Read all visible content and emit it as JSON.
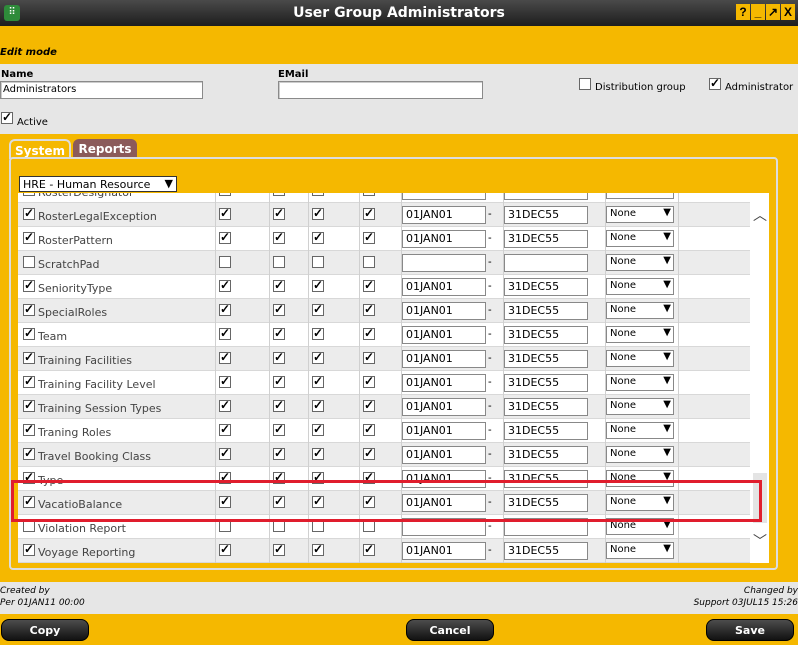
{
  "window": {
    "title": "User Group Administrators",
    "help": "?",
    "minimize": "_",
    "maximize": "↗",
    "close": "X"
  },
  "edit_mode": "Edit mode",
  "form": {
    "name_label": "Name",
    "name_value": "Administrators",
    "email_label": "EMail",
    "email_value": "",
    "distribution_label": "Distribution group",
    "distribution_checked": false,
    "administrator_label": "Administrator",
    "administrator_checked": true,
    "active_label": "Active",
    "active_checked": true
  },
  "tabs": [
    {
      "label": "System",
      "active": true
    },
    {
      "label": "Reports",
      "active": false
    }
  ],
  "module_select": {
    "value": "HRE - Human Resource"
  },
  "rows": [
    {
      "name": "RosterDesignator",
      "checked": true,
      "perms": [
        true,
        true,
        true,
        true
      ],
      "from": "",
      "to": "",
      "sel": ""
    },
    {
      "name": "RosterLegalException",
      "checked": true,
      "perms": [
        true,
        true,
        true,
        true
      ],
      "from": "01JAN01",
      "to": "31DEC55",
      "sel": "None"
    },
    {
      "name": "RosterPattern",
      "checked": true,
      "perms": [
        true,
        true,
        true,
        true
      ],
      "from": "01JAN01",
      "to": "31DEC55",
      "sel": "None"
    },
    {
      "name": "ScratchPad",
      "checked": false,
      "perms": [
        false,
        false,
        false,
        false
      ],
      "from": "",
      "to": "",
      "sel": "None"
    },
    {
      "name": "SeniorityType",
      "checked": true,
      "perms": [
        true,
        true,
        true,
        true
      ],
      "from": "01JAN01",
      "to": "31DEC55",
      "sel": "None"
    },
    {
      "name": "SpecialRoles",
      "checked": true,
      "perms": [
        true,
        true,
        true,
        true
      ],
      "from": "01JAN01",
      "to": "31DEC55",
      "sel": "None"
    },
    {
      "name": "Team",
      "checked": true,
      "perms": [
        true,
        true,
        true,
        true
      ],
      "from": "01JAN01",
      "to": "31DEC55",
      "sel": "None"
    },
    {
      "name": "Training Facilities",
      "checked": true,
      "perms": [
        true,
        true,
        true,
        true
      ],
      "from": "01JAN01",
      "to": "31DEC55",
      "sel": "None"
    },
    {
      "name": "Training Facility Level",
      "checked": true,
      "perms": [
        true,
        true,
        true,
        true
      ],
      "from": "01JAN01",
      "to": "31DEC55",
      "sel": "None"
    },
    {
      "name": "Training Session Types",
      "checked": true,
      "perms": [
        true,
        true,
        true,
        true
      ],
      "from": "01JAN01",
      "to": "31DEC55",
      "sel": "None"
    },
    {
      "name": "Traning Roles",
      "checked": true,
      "perms": [
        true,
        true,
        true,
        true
      ],
      "from": "01JAN01",
      "to": "31DEC55",
      "sel": "None"
    },
    {
      "name": "Travel Booking Class",
      "checked": true,
      "perms": [
        true,
        true,
        true,
        true
      ],
      "from": "01JAN01",
      "to": "31DEC55",
      "sel": "None"
    },
    {
      "name": "Type",
      "checked": true,
      "perms": [
        true,
        true,
        true,
        true
      ],
      "from": "01JAN01",
      "to": "31DEC55",
      "sel": "None"
    },
    {
      "name": "VacatioBalance",
      "checked": true,
      "perms": [
        true,
        true,
        true,
        true
      ],
      "from": "01JAN01",
      "to": "31DEC55",
      "sel": "None"
    },
    {
      "name": "Violation Report",
      "checked": false,
      "perms": [
        false,
        false,
        false,
        false
      ],
      "from": "",
      "to": "",
      "sel": "None"
    },
    {
      "name": "Voyage Reporting",
      "checked": true,
      "perms": [
        true,
        true,
        true,
        true
      ],
      "from": "01JAN01",
      "to": "31DEC55",
      "sel": "None"
    }
  ],
  "footer": {
    "created_by_label": "Created by",
    "created_by_value": "Per 01JAN11 00:00",
    "changed_by_label": "Changed by",
    "changed_by_value": "Support 03JUL15 15:26"
  },
  "buttons": {
    "copy": "Copy",
    "cancel": "Cancel",
    "save": "Save"
  },
  "colors": {
    "background": "#F5B800",
    "highlight": "#E01D2D",
    "tab_active": "#F5B800",
    "tab_inactive": "#8B5A5A"
  }
}
